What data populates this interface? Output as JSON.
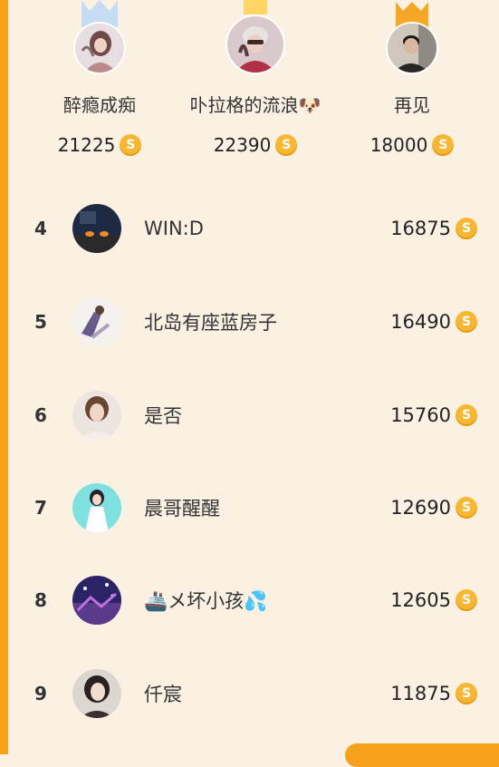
{
  "colors": {
    "background": "#fbf1e3",
    "accent": "#f5a11c",
    "coin": "#f7b733",
    "crown_first": "#ffd666",
    "crown_second": "#bcd6f0",
    "crown_third": "#f5a623"
  },
  "coin_symbol": "S",
  "podium": [
    {
      "place": 2,
      "name": "醉瘾成痴",
      "score": "21225",
      "crown": "silver-crown-icon"
    },
    {
      "place": 1,
      "name": "卟拉格的流浪🐶",
      "score": "22390",
      "crown": "gold-crown-icon"
    },
    {
      "place": 3,
      "name": "再见",
      "score": "18000",
      "crown": "bronze-crown-icon"
    }
  ],
  "ranking": [
    {
      "rank": "4",
      "name": "WIN:D",
      "score": "16875"
    },
    {
      "rank": "5",
      "name": "北岛有座蓝房子",
      "score": "16490"
    },
    {
      "rank": "6",
      "name": "是否",
      "score": "15760"
    },
    {
      "rank": "7",
      "name": "晨哥醒醒",
      "score": "12690"
    },
    {
      "rank": "8",
      "name": "🚢メ坏小孩💦",
      "score": "12605"
    },
    {
      "rank": "9",
      "name": "仟宸",
      "score": "11875"
    }
  ]
}
